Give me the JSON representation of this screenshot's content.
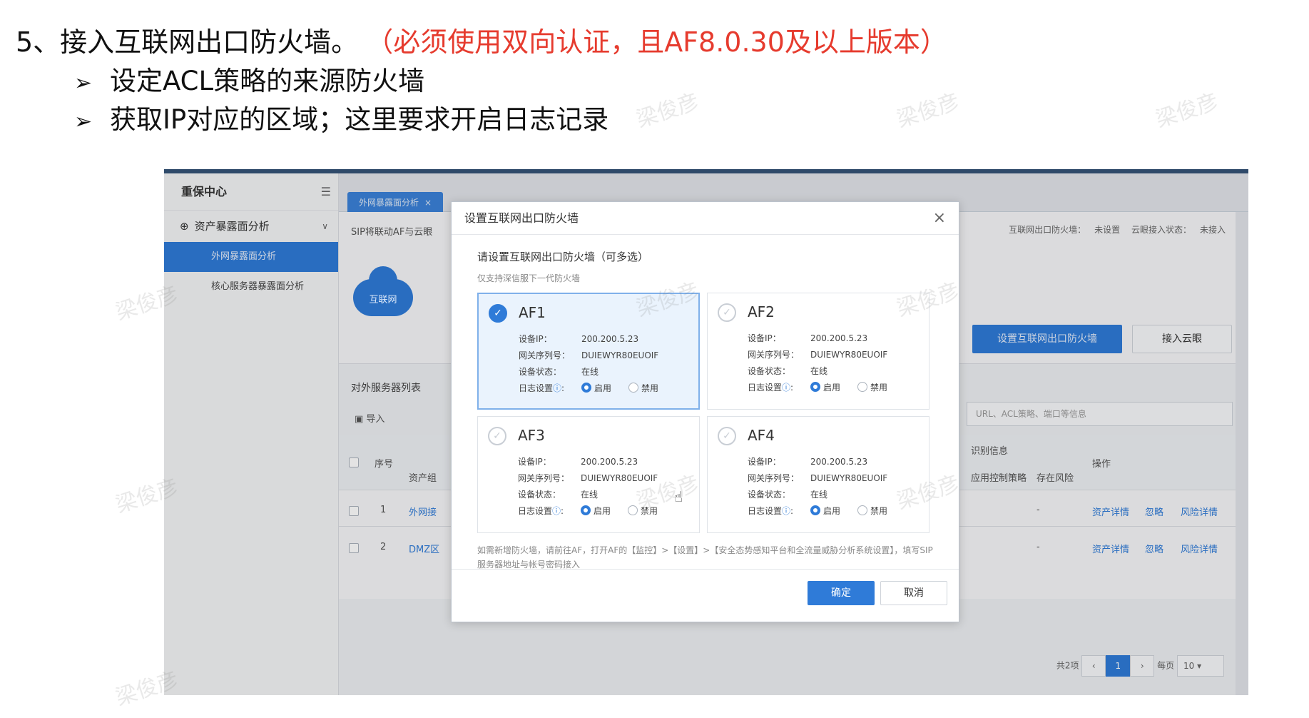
{
  "slide": {
    "title": "5、接入互联网出口防火墙。",
    "title_note": "（必须使用双向认证，且AF8.0.30及以上版本）",
    "bullets": [
      "设定ACL策略的来源防火墙",
      "获取IP对应的区域；这里要求开启日志记录"
    ],
    "watermark": "梁俊彦"
  },
  "sidebar": {
    "header": "重保中心",
    "group": "资产暴露面分析",
    "items": [
      "外网暴露面分析",
      "核心服务器暴露面分析"
    ]
  },
  "tabs": [
    {
      "label": "外网暴露面分析"
    }
  ],
  "topcard": {
    "left_text": "SIP将联动AF与云眼",
    "status_firewall_label": "互联网出口防火墙：",
    "status_firewall_value": "未设置",
    "status_cloud_label": "云眼接入状态：",
    "status_cloud_value": "未接入",
    "cloud_label": "互联网",
    "btn_set_firewall": "设置互联网出口防火墙",
    "btn_connect_cloud": "接入云眼"
  },
  "server_list": {
    "title": "对外服务器列表",
    "import_label": "导入",
    "search_placeholder": "URL、ACL策略、端口等信息",
    "headers": {
      "seq": "序号",
      "asset_group": "资产组",
      "identify_info": "识别信息",
      "app_control": "应用控制策略",
      "risk": "存在风险",
      "ops": "操作"
    },
    "rows": [
      {
        "seq": "1",
        "group": "外网接",
        "risk": "-",
        "op1": "资产详情",
        "op2": "忽略",
        "op3": "风险详情"
      },
      {
        "seq": "2",
        "group": "DMZ区",
        "risk": "-",
        "op1": "资产详情",
        "op2": "忽略",
        "op3": "风险详情"
      }
    ],
    "pager": {
      "total": "共2项",
      "current": "1",
      "per_page_label": "每页",
      "per_page": "10"
    }
  },
  "modal": {
    "title": "设置互联网出口防火墙",
    "subtitle": "请设置互联网出口防火墙（可多选）",
    "tip": "仅支持深信服下一代防火墙",
    "labels": {
      "ip": "设备IP：",
      "serial": "网关序列号：",
      "status": "设备状态：",
      "log": "日志设置",
      "enable": "启用",
      "disable": "禁用"
    },
    "firewalls": [
      {
        "name": "AF1",
        "ip": "200.200.5.23",
        "serial": "DUIEWYR80EUOIF",
        "status": "在线",
        "selected": true
      },
      {
        "name": "AF2",
        "ip": "200.200.5.23",
        "serial": "DUIEWYR80EUOIF",
        "status": "在线",
        "selected": false
      },
      {
        "name": "AF3",
        "ip": "200.200.5.23",
        "serial": "DUIEWYR80EUOIF",
        "status": "在线",
        "selected": false
      },
      {
        "name": "AF4",
        "ip": "200.200.5.23",
        "serial": "DUIEWYR80EUOIF",
        "status": "在线",
        "selected": false
      }
    ],
    "note": "如需新增防火墙，请前往AF，打开AF的【监控】>【设置】>【安全态势感知平台和全流量威胁分析系统设置】，填写SIP服务器地址与帐号密码接入",
    "ok": "确定",
    "cancel": "取消"
  }
}
